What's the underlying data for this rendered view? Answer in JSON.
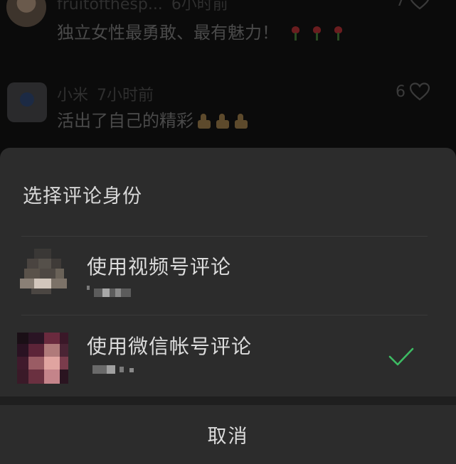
{
  "comments": [
    {
      "username": "fruitofthesp...",
      "time": "6小时前",
      "text": "独立女性最勇敢、最有魅力！",
      "likes": "7",
      "emoji": [
        "rose",
        "rose",
        "rose"
      ]
    },
    {
      "username": "小米",
      "time": "7小时前",
      "text": "活出了自己的精彩",
      "likes": "6",
      "emoji": [
        "thumbs-up",
        "thumbs-up",
        "thumbs-up"
      ]
    }
  ],
  "sheet": {
    "title": "选择评论身份",
    "options": [
      {
        "label": "使用视频号评论",
        "selected": false
      },
      {
        "label": "使用微信帐号评论",
        "selected": true
      }
    ],
    "cancel": "取消"
  },
  "colors": {
    "check": "#3dbb63",
    "sheet_bg": "#2c2c2c",
    "backdrop": "#0b0b0b"
  }
}
